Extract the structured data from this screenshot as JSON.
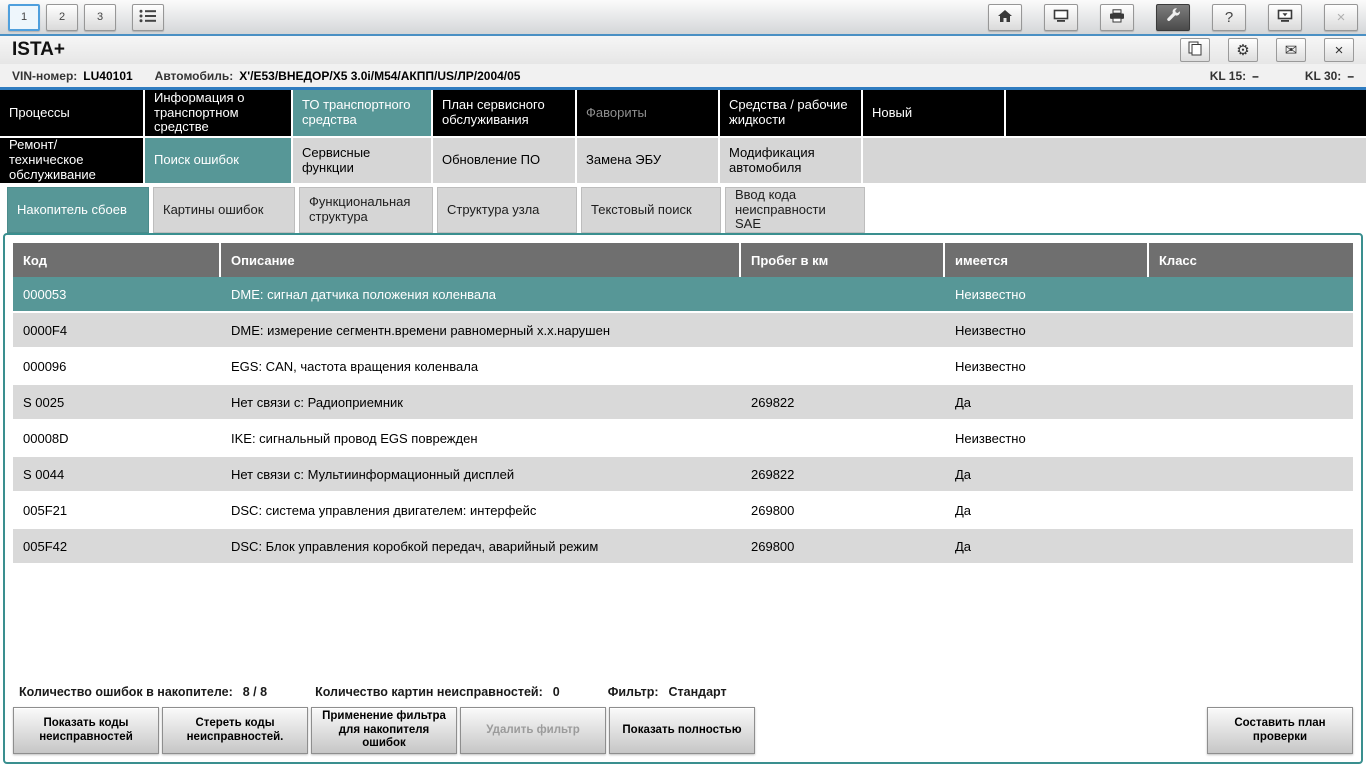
{
  "colors": {
    "teal": "#579797",
    "frame_border": "#3a8f8f",
    "blue_line": "#2f7cc0",
    "header_gray": "#6f6f6f",
    "row_alt": "#d9d9d9"
  },
  "toolbar": {
    "session_tabs": [
      "1",
      "2",
      "3"
    ],
    "icons": {
      "help": "?",
      "close": "×",
      "gear": "⚙",
      "mail": "✉"
    }
  },
  "titlebar": {
    "app_title": "ISTA+"
  },
  "vinbar": {
    "vin_label": "VIN-номер:",
    "vin_value": "LU40101",
    "vehicle_label": "Автомобиль:",
    "vehicle_value": "X'/E53/ВНЕДОР/X5 3.0i/M54/АКПП/US/ЛР/2004/05",
    "kl15_label": "KL 15:",
    "kl15_value": "–",
    "kl30_label": "KL 30:",
    "kl30_value": "–"
  },
  "main_menu": [
    {
      "label": "Процессы"
    },
    {
      "label": "Информация о транспортном средстве"
    },
    {
      "label": "ТО транспортного средства",
      "state": "active"
    },
    {
      "label": "План сервисного обслуживания"
    },
    {
      "label": "Фавориты",
      "state": "disabled"
    },
    {
      "label": "Средства / рабочие жидкости"
    },
    {
      "label": "Новый"
    }
  ],
  "sub_menu": [
    {
      "label": "Ремонт/ техническое обслуживание",
      "state": "dark"
    },
    {
      "label": "Поиск ошибок",
      "state": "active"
    },
    {
      "label": "Сервисные функции"
    },
    {
      "label": "Обновление ПО"
    },
    {
      "label": "Замена ЭБУ"
    },
    {
      "label": "Модификация автомобиля"
    }
  ],
  "function_tabs": [
    {
      "label": "Накопитель сбоев",
      "state": "active"
    },
    {
      "label": "Картины ошибок"
    },
    {
      "label": "Функциональная структура"
    },
    {
      "label": "Структура узла"
    },
    {
      "label": "Текстовый поиск"
    },
    {
      "label": "Ввод кода неисправности SAE"
    }
  ],
  "table": {
    "columns": [
      "Код",
      "Описание",
      "Пробег в км",
      "имеется",
      "Класс"
    ],
    "rows": [
      {
        "cells": [
          "000053",
          "DME: сигнал датчика положения коленвала",
          "",
          "Неизвестно",
          ""
        ],
        "selected": true
      },
      {
        "cells": [
          "0000F4",
          "DME: измерение сегментн.времени равномерный х.х.нарушен",
          "",
          "Неизвестно",
          ""
        ]
      },
      {
        "cells": [
          "000096",
          "EGS: CAN, частота вращения коленвала",
          "",
          "Неизвестно",
          ""
        ]
      },
      {
        "cells": [
          "S 0025",
          "Нет связи с: Радиоприемник",
          "269822",
          "Да",
          ""
        ]
      },
      {
        "cells": [
          "00008D",
          "IKE: сигнальный провод EGS поврежден",
          "",
          "Неизвестно",
          ""
        ]
      },
      {
        "cells": [
          "S 0044",
          "Нет связи с: Мультиинформационный дисплей",
          "269822",
          "Да",
          ""
        ]
      },
      {
        "cells": [
          "005F21",
          "DSC: система управления двигателем: интерфейс",
          "269800",
          "Да",
          ""
        ]
      },
      {
        "cells": [
          "005F42",
          "DSC: Блок управления коробкой передач, аварийный режим",
          "269800",
          "Да",
          ""
        ]
      }
    ]
  },
  "status": {
    "errors_label": "Количество ошибок в накопителе:",
    "errors_value": "8 / 8",
    "patterns_label": "Количество картин неисправностей:",
    "patterns_value": "0",
    "filter_label": "Фильтр:",
    "filter_value": "Стандарт"
  },
  "footer": {
    "buttons_left": [
      {
        "label": "Показать коды неисправностей"
      },
      {
        "label": "Стереть коды неисправностей."
      },
      {
        "label": "Применение фильтра для накопителя ошибок"
      },
      {
        "label": "Удалить фильтр",
        "disabled": true
      },
      {
        "label": "Показать полностью"
      }
    ],
    "button_right": {
      "label": "Составить план проверки"
    }
  }
}
